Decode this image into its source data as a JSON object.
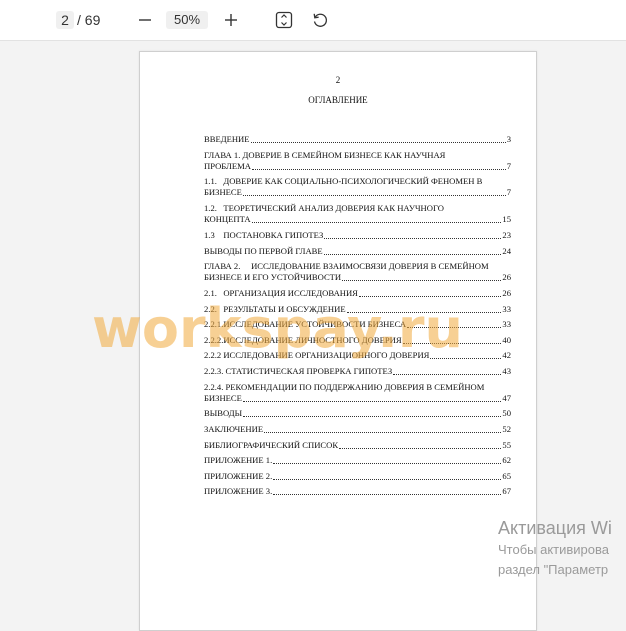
{
  "toolbar": {
    "current_page": "2",
    "total_pages": "/ 69",
    "zoom_level": "50%",
    "icons": {
      "zoom_out": "minus-icon",
      "zoom_in": "plus-icon",
      "fit": "fit-page-icon",
      "rotate": "rotate-icon"
    }
  },
  "document": {
    "page_number": "2",
    "title": "ОГЛАВЛЕНИЕ",
    "toc": [
      {
        "line1": "ВВЕДЕНИЕ",
        "line2": "",
        "page": "3"
      },
      {
        "line1": "ГЛАВА 1. ДОВЕРИЕ В СЕМЕЙНОМ БИЗНЕСЕ КАК НАУЧНАЯ",
        "line2": "ПРОБЛЕМА",
        "page": "7"
      },
      {
        "line1": "1.1.   ДОВЕРИЕ КАК СОЦИАЛЬНО-ПСИХОЛОГИЧЕСКИЙ ФЕНОМЕН В",
        "line2": "БИЗНЕСЕ",
        "page": "7"
      },
      {
        "line1": "1.2.   ТЕОРЕТИЧЕСКИЙ АНАЛИЗ ДОВЕРИЯ КАК НАУЧНОГО",
        "line2": "КОНЦЕПТА",
        "page": "15"
      },
      {
        "line1": "1.3    ПОСТАНОВКА ГИПОТЕЗ",
        "line2": "",
        "page": "23"
      },
      {
        "line1": "ВЫВОДЫ ПО ПЕРВОЙ ГЛАВЕ",
        "line2": "",
        "page": "24"
      },
      {
        "line1": "ГЛАВА 2.     ИССЛЕДОВАНИЕ ВЗАИМОСВЯЗИ ДОВЕРИЯ В СЕМЕЙНОМ",
        "line2": "БИЗНЕСЕ И ЕГО УСТОЙЧИВОСТИ",
        "page": "26"
      },
      {
        "line1": "2.1.   ОРГАНИЗАЦИЯ ИССЛЕДОВАНИЯ",
        "line2": "",
        "page": "26"
      },
      {
        "line1": "2.2.   РЕЗУЛЬТАТЫ И ОБСУЖДЕНИЕ",
        "line2": "",
        "page": "33"
      },
      {
        "line1": "2.2.1.ИССЛЕДОВАНИЕ УСТОЙЧИВОСТИ БИЗНЕСА",
        "line2": "",
        "page": "33"
      },
      {
        "line1": "2.2.2.ИССЛЕДОВАНИЕ ЛИЧНОСТНОГО ДОВЕРИЯ",
        "line2": "",
        "page": "40"
      },
      {
        "line1": "2.2.2 ИССЛЕДОВАНИЕ ОРГАНИЗАЦИОННОГО ДОВЕРИЯ",
        "line2": "",
        "page": "42"
      },
      {
        "line1": "2.2.3. СТАТИСТИЧЕСКАЯ ПРОВЕРКА ГИПОТЕЗ",
        "line2": "",
        "page": "43"
      },
      {
        "line1": "2.2.4. РЕКОМЕНДАЦИИ ПО ПОДДЕРЖАНИЮ ДОВЕРИЯ В СЕМЕЙНОМ",
        "line2": "БИЗНЕСЕ",
        "page": "47"
      },
      {
        "line1": "ВЫВОДЫ",
        "line2": "",
        "page": "50"
      },
      {
        "line1": "ЗАКЛЮЧЕНИЕ",
        "line2": "",
        "page": "52"
      },
      {
        "line1": "БИБЛИОГРАФИЧЕСКИЙ СПИСОК",
        "line2": "",
        "page": "55"
      },
      {
        "line1": "ПРИЛОЖЕНИЕ 1.",
        "line2": "",
        "page": "62"
      },
      {
        "line1": "ПРИЛОЖЕНИЕ 2.",
        "line2": "",
        "page": "65"
      },
      {
        "line1": "ПРИЛОЖЕНИЕ 3.",
        "line2": "",
        "page": "67"
      }
    ]
  },
  "watermark": "workspay.ru",
  "activation": {
    "line1": "Активация Wi",
    "line2": "Чтобы активирова",
    "line3": "раздел \"Параметр"
  }
}
